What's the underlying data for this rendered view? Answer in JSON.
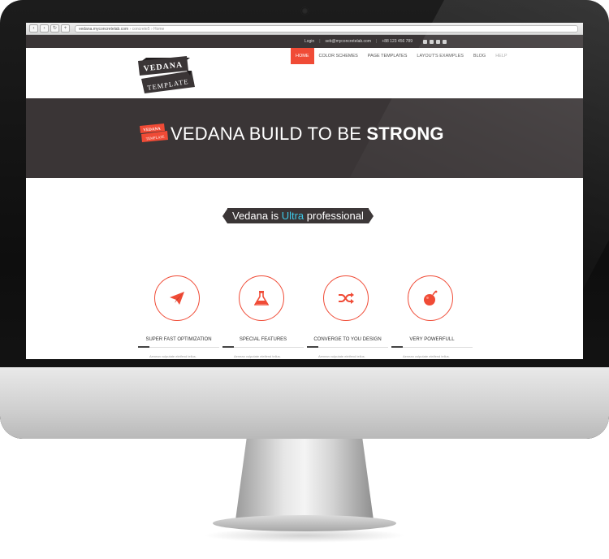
{
  "browser": {
    "url": "vedana.myconcretelab.com",
    "breadcrumb": "› concrete5 › Home"
  },
  "topbar": {
    "login": "Login",
    "separator": "|",
    "email": "seb@myconcretelab.com",
    "phone": "+88 123 456 789",
    "social_icons": [
      "facebook-icon",
      "google-plus-icon",
      "instagram-icon",
      "twitter-icon"
    ]
  },
  "logo": {
    "line1": "VEDANA",
    "line2": "TEMPLATE"
  },
  "nav": {
    "items": [
      {
        "label": "HOME",
        "active": true
      },
      {
        "label": "COLOR SCHEMES"
      },
      {
        "label": "PAGE TEMPLATES"
      },
      {
        "label": "LAYOUT'S EXAMPLES"
      },
      {
        "label": "BLOG"
      },
      {
        "label": "HELP"
      }
    ]
  },
  "hero": {
    "badge_line1": "VEDANA",
    "badge_line2": "TEMPLATE",
    "title_part1": "VEDANA BUILD TO BE ",
    "title_bold": "STRONG"
  },
  "tagline": {
    "before": "Vedana is ",
    "highlight": "Ultra",
    "after": " professional"
  },
  "features": [
    {
      "icon": "paper-plane-icon",
      "title": "SUPER FAST OPTIMIZATION",
      "desc": "Aenean vulputate eleifend tellus."
    },
    {
      "icon": "flask-icon",
      "title": "SPECIAL FEATURES",
      "desc": "Aenean vulputate eleifend tellus."
    },
    {
      "icon": "shuffle-icon",
      "title": "CONVERGE TO YOU DESIGN",
      "desc": "Aenean vulputate eleifend tellus."
    },
    {
      "icon": "bomb-icon",
      "title": "VERY POWERFULL",
      "desc": "Aenean vulputate eleifend tellus."
    }
  ],
  "colors": {
    "accent": "#f04b36",
    "dark": "#3a3536",
    "highlight": "#3ec8e6"
  }
}
